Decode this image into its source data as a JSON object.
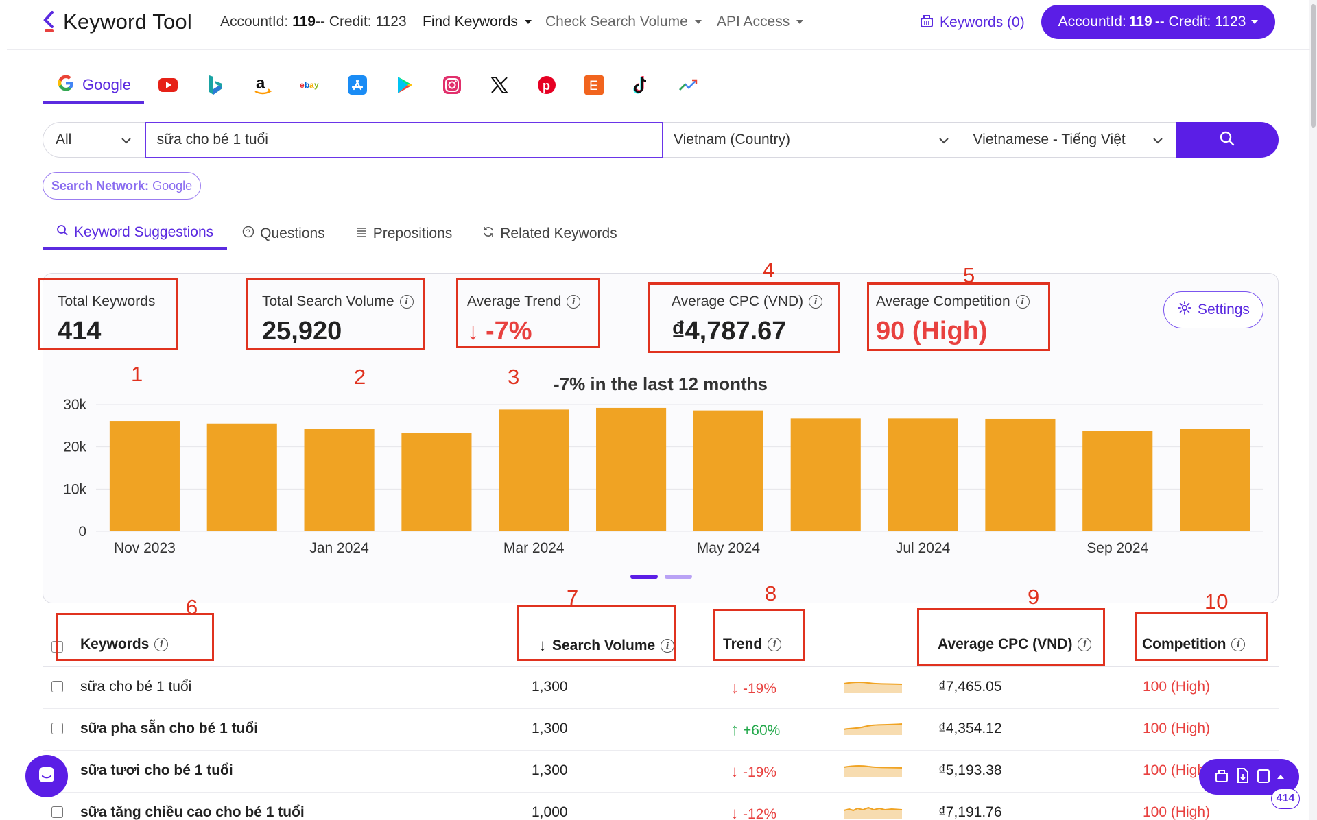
{
  "header": {
    "logo_text": "Keyword Tool",
    "account_label": "AccountId: ",
    "account_id": "119",
    "credit_label": "-- Credit: 1123",
    "nav": [
      "Find Keywords",
      "Check Search Volume",
      "API Access"
    ],
    "keywords_basket": "Keywords (0)",
    "account_button_prefix": "AccountId: ",
    "account_button_id": "119",
    "account_button_suffix": " -- Credit: 1123"
  },
  "sources": {
    "active": "Google",
    "icons": [
      "youtube-icon",
      "bing-icon",
      "amazon-icon",
      "ebay-icon",
      "app-store-icon",
      "play-store-icon",
      "instagram-icon",
      "x-twitter-icon",
      "pinterest-icon",
      "etsy-icon",
      "tiktok-icon",
      "trends-icon"
    ]
  },
  "search": {
    "type": "All",
    "query": "sữa cho bé 1 tuổi",
    "country": "Vietnam (Country)",
    "language": "Vietnamese - Tiếng Việt"
  },
  "network_pill": {
    "label": "Search Network:",
    "value": "Google"
  },
  "subtabs": [
    "Keyword Suggestions",
    "Questions",
    "Prepositions",
    "Related Keywords"
  ],
  "stats": {
    "total_keywords_label": "Total Keywords",
    "total_keywords": "414",
    "total_volume_label": "Total Search Volume",
    "total_volume": "25,920",
    "avg_trend_label": "Average Trend",
    "avg_trend_arrow": "↓",
    "avg_trend": "-7%",
    "avg_cpc_label": "Average CPC (VND)",
    "avg_cpc": "₫4,787.67",
    "avg_comp_label": "Average Competition",
    "avg_comp": "90 (High)",
    "settings": "Settings"
  },
  "annotations": [
    "1",
    "2",
    "3",
    "4",
    "5",
    "6",
    "7",
    "8",
    "9",
    "10"
  ],
  "chart_data": {
    "type": "bar",
    "title": "-7% in the last 12 months",
    "categories": [
      "Nov 2023",
      "Dec 2023",
      "Jan 2024",
      "Feb 2024",
      "Mar 2024",
      "Apr 2024",
      "May 2024",
      "Jun 2024",
      "Jul 2024",
      "Aug 2024",
      "Sep 2024",
      "Oct 2024"
    ],
    "values": [
      26100,
      25500,
      24200,
      23200,
      28800,
      29200,
      28600,
      26700,
      26700,
      26600,
      23700,
      24300
    ],
    "xtick_labels": [
      "Nov 2023",
      "",
      "Jan 2024",
      "",
      "Mar 2024",
      "",
      "May 2024",
      "",
      "Jul 2024",
      "",
      "Sep 2024",
      ""
    ],
    "yticks": [
      "0",
      "10k",
      "20k",
      "30k"
    ],
    "ylim": [
      0,
      30000
    ],
    "color": "#f0a323",
    "grid": true
  },
  "table": {
    "headers": {
      "keywords": "Keywords",
      "volume_arrow": "↓",
      "volume": "Search Volume",
      "trend": "Trend",
      "cpc": "Average CPC (VND)",
      "competition": "Competition"
    },
    "rows": [
      {
        "keyword": "sữa cho bé 1 tuổi",
        "bold": false,
        "volume": "1,300",
        "trend_arrow": "↓",
        "trend": "-19%",
        "dir": "down",
        "cpc": "₫7,465.05",
        "competition": "100 (High)"
      },
      {
        "keyword": "sữa pha sẵn cho bé 1 tuổi",
        "bold": true,
        "volume": "1,300",
        "trend_arrow": "↑",
        "trend": "+60%",
        "dir": "up",
        "cpc": "₫4,354.12",
        "competition": "100 (High)"
      },
      {
        "keyword": "sữa tươi cho bé 1 tuổi",
        "bold": true,
        "volume": "1,300",
        "trend_arrow": "↓",
        "trend": "-19%",
        "dir": "down",
        "cpc": "₫5,193.38",
        "competition": "100 (High)"
      },
      {
        "keyword": "sữa tăng chiều cao cho bé 1 tuổi",
        "bold": true,
        "volume": "1,000",
        "trend_arrow": "↓",
        "trend": "-12%",
        "dir": "down",
        "cpc": "₫7,191.76",
        "competition": "100 (High)"
      }
    ]
  },
  "fab": {
    "badge": "414"
  },
  "colors": {
    "accent": "#5b1ee6",
    "bar": "#f0a323",
    "negative": "#e8413f",
    "positive": "#22a84a",
    "annotation": "#e0321f"
  }
}
